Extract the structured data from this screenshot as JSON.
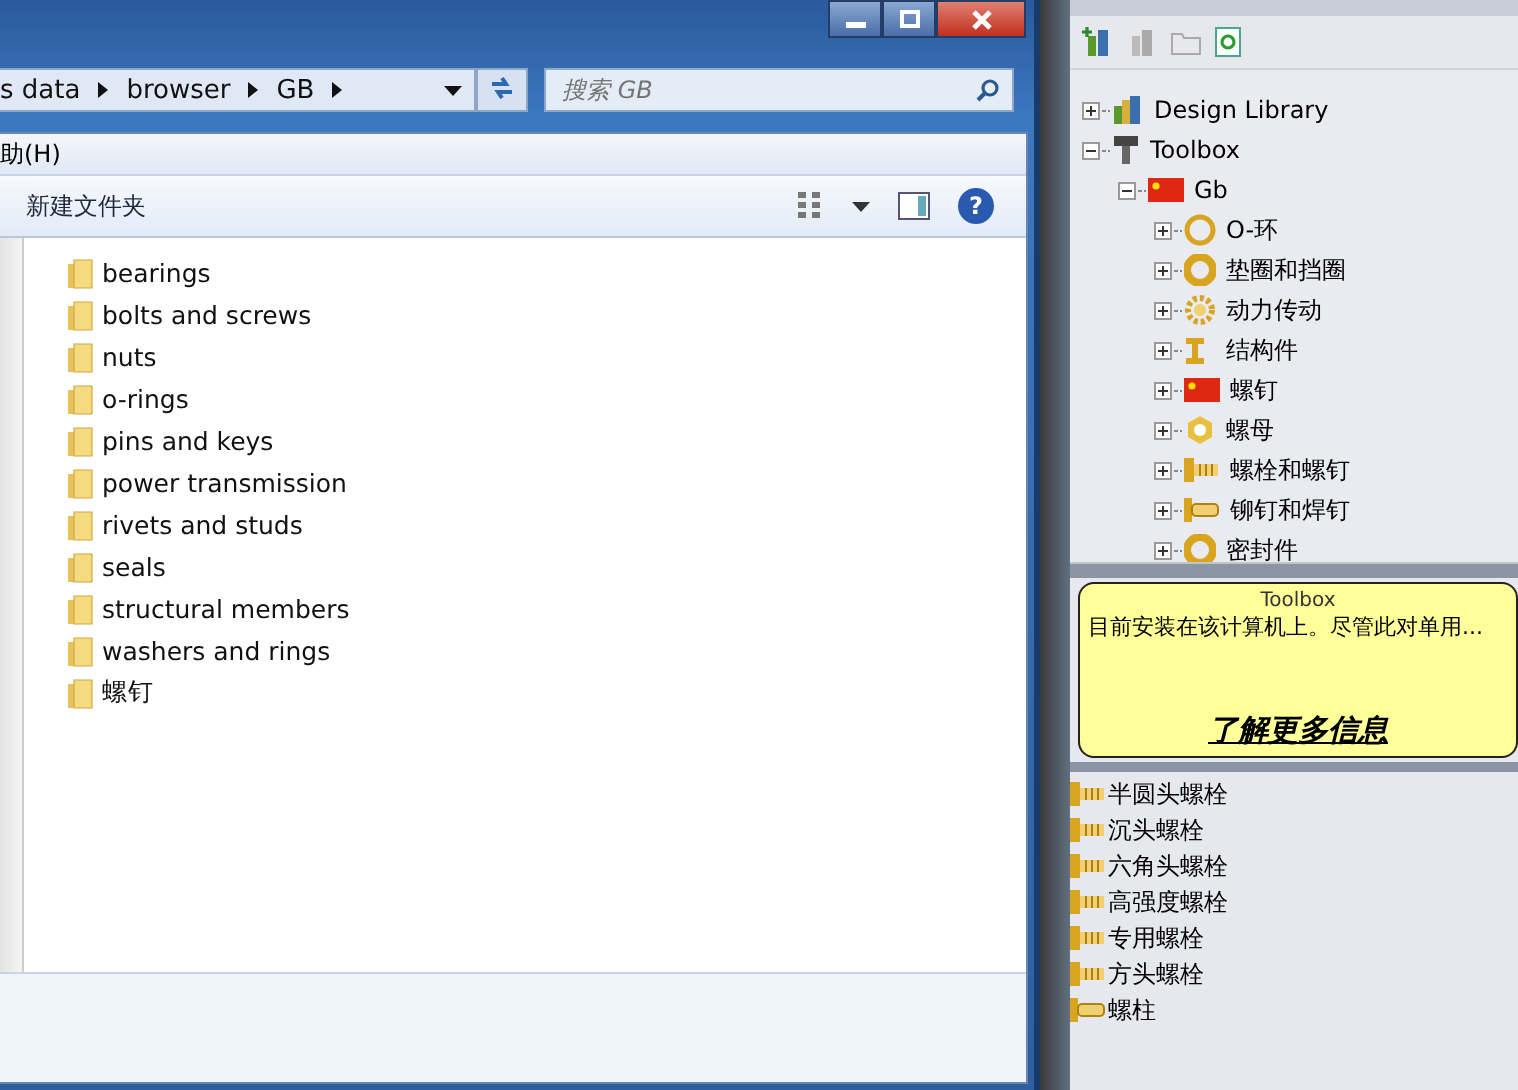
{
  "explorer": {
    "breadcrumb": [
      "s data",
      "browser",
      "GB"
    ],
    "search": {
      "placeholder": "搜索 GB"
    },
    "menu": [
      "助(H)"
    ],
    "toolbar": {
      "new_folder": "新建文件夹",
      "help": "?"
    },
    "folders": [
      {
        "name": "bearings"
      },
      {
        "name": "bolts and screws"
      },
      {
        "name": "nuts"
      },
      {
        "name": "o-rings"
      },
      {
        "name": "pins and keys"
      },
      {
        "name": "power transmission"
      },
      {
        "name": "rivets and studs"
      },
      {
        "name": "seals"
      },
      {
        "name": "structural members"
      },
      {
        "name": "washers and rings"
      },
      {
        "name": "螺钉"
      }
    ]
  },
  "design_library": {
    "tree": [
      {
        "label": "Design Library",
        "kind": "library",
        "expanded": false
      },
      {
        "label": "Toolbox",
        "kind": "toolbox",
        "expanded": true,
        "children": [
          {
            "label": "Gb",
            "kind": "flag",
            "expanded": true,
            "children": [
              {
                "label": "O-环",
                "kind": "ring",
                "expanded": false
              },
              {
                "label": "垫圈和挡圈",
                "kind": "washer",
                "expanded": false
              },
              {
                "label": "动力传动",
                "kind": "gear",
                "expanded": false
              },
              {
                "label": "结构件",
                "kind": "beam",
                "expanded": false
              },
              {
                "label": "螺钉",
                "kind": "flag",
                "expanded": false
              },
              {
                "label": "螺母",
                "kind": "nut",
                "expanded": false
              },
              {
                "label": "螺栓和螺钉",
                "kind": "bolt",
                "expanded": false
              },
              {
                "label": "铆钉和焊钉",
                "kind": "rivet",
                "expanded": false
              },
              {
                "label": "密封件",
                "kind": "washer",
                "expanded": false
              }
            ]
          }
        ]
      }
    ],
    "info": {
      "title": "Toolbox",
      "text": "目前安装在该计算机上。尽管此对单用...",
      "link": "了解更多信息"
    },
    "parts": [
      {
        "label": "半圆头螺栓",
        "kind": "bolt"
      },
      {
        "label": "沉头螺栓",
        "kind": "bolt"
      },
      {
        "label": "六角头螺栓",
        "kind": "bolt"
      },
      {
        "label": "高强度螺栓",
        "kind": "bolt"
      },
      {
        "label": "专用螺栓",
        "kind": "bolt"
      },
      {
        "label": "方头螺栓",
        "kind": "bolt"
      },
      {
        "label": "螺柱",
        "kind": "stud"
      }
    ]
  }
}
